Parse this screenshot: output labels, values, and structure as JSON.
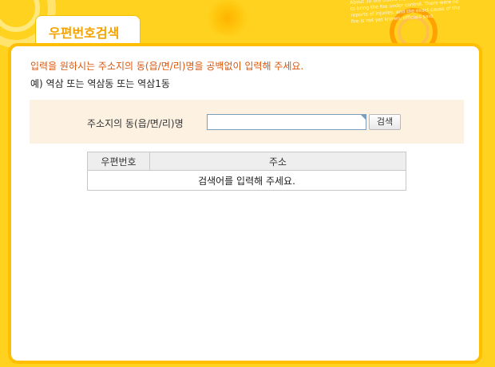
{
  "page": {
    "title": "우편번호검색",
    "decoration_text": "About 30 fire trucks were rushed to the scene to bring the fire under control. There were no reports of injuries, and the exact cause of the fire is not yet known, officials said."
  },
  "instructions": {
    "main": "입력을 원하시는 주소지의 동(읍/면/리)명을 공백없이 입력해 주세요.",
    "example": "예) 역삼 또는 역삼동 또는 역삼1동"
  },
  "search": {
    "label": "주소지의 동(읍/면/리)명",
    "input_value": "",
    "button_label": "검색"
  },
  "results": {
    "columns": [
      "우편번호",
      "주소"
    ],
    "empty_message": "검색어를 입력해 주세요."
  },
  "colors": {
    "background": "#ffd21f",
    "panel_border": "#ffbf00",
    "title_text": "#f5a300",
    "instruction_text": "#d9570c",
    "search_area_bg": "#fdf1e2"
  }
}
